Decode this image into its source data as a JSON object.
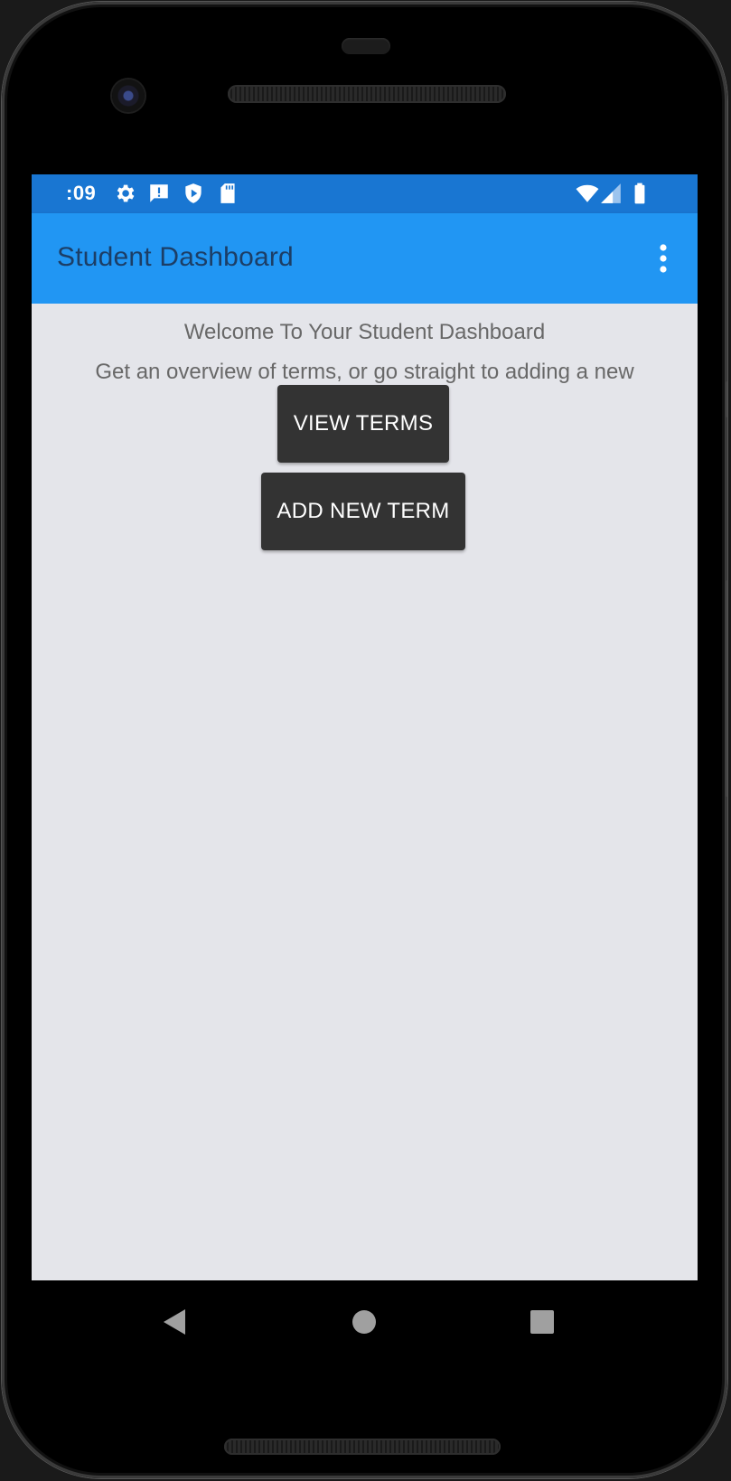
{
  "status_bar": {
    "time": ":09",
    "left_icons": [
      "gear-icon",
      "alert-message-icon",
      "shield-play-icon",
      "sd-card-icon"
    ],
    "right_icons": [
      "wifi-icon",
      "cell-signal-icon",
      "battery-icon"
    ]
  },
  "app_bar": {
    "title": "Student Dashboard",
    "menu_icon": "overflow-menu-icon"
  },
  "main": {
    "welcome_text": "Welcome To Your Student Dashboard",
    "subtitle_text": "Get an overview of terms, or go straight to adding a new",
    "view_terms_label": "VIEW TERMS",
    "add_new_term_label": "ADD NEW TERM"
  },
  "nav_bar": {
    "icons": [
      "back-icon",
      "home-icon",
      "recents-icon"
    ]
  },
  "colors": {
    "status_bar": "#1976d2",
    "app_bar": "#2196f3",
    "title_text": "#1c3e66",
    "content_bg": "#e4e5ea",
    "body_text": "#686868",
    "button_bg": "#333333",
    "button_text": "#ffffff"
  }
}
